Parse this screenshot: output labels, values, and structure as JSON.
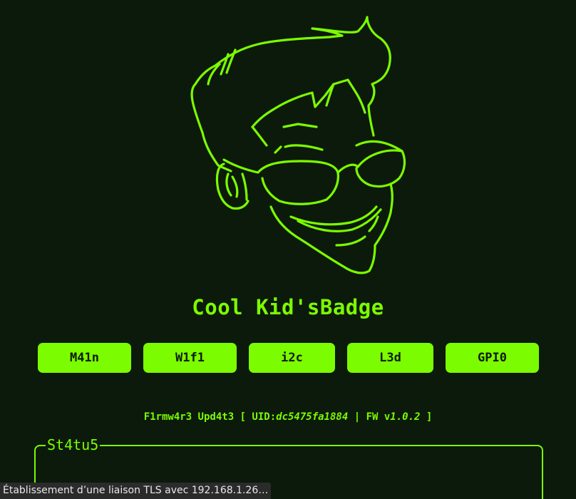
{
  "colors": {
    "background": "#0b1a0b",
    "accent": "#7cfc00",
    "button_text": "#0b1a0b",
    "statusbar_bg": "#2b2b2b",
    "statusbar_text": "#e8e8e8"
  },
  "logo": {
    "icon": "cool-kid-face-logo"
  },
  "header": {
    "title": "Cool Kid'sBadge"
  },
  "nav": {
    "items": [
      {
        "label": "M41n"
      },
      {
        "label": "W1f1"
      },
      {
        "label": "i2c"
      },
      {
        "label": "L3d"
      },
      {
        "label": "GPI0"
      }
    ]
  },
  "firmware": {
    "prefix": "F1rmw4r3 Upd4t3 [ UID:",
    "uid": "dc5475fa1884",
    "mid": " | FW v",
    "version": "1.0.2",
    "suffix": " ]"
  },
  "status": {
    "legend": "St4tu5"
  },
  "browser_status": {
    "text": "Établissement d’une liaison TLS avec 192.168.1.26…"
  }
}
